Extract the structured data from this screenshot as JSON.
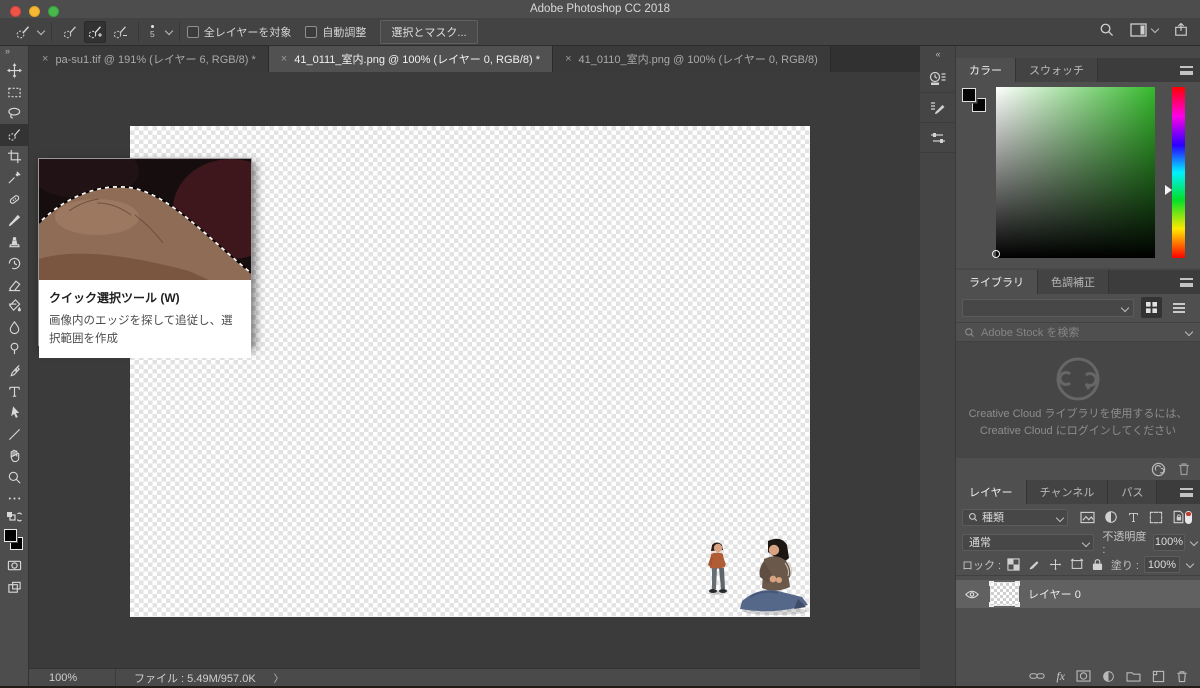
{
  "window": {
    "title": "Adobe Photoshop CC 2018"
  },
  "options_bar": {
    "brush_size": "5",
    "sample_all_layers_label": "全レイヤーを対象",
    "auto_enhance_label": "自動調整",
    "select_and_mask_label": "選択とマスク..."
  },
  "tabs": [
    {
      "label": "pa-su1.tif @ 191% (レイヤー 6, RGB/8) *",
      "active": false
    },
    {
      "label": "41_0111_室内.png @ 100% (レイヤー 0, RGB/8) *",
      "active": true
    },
    {
      "label": "41_0110_室内.png @ 100% (レイヤー 0, RGB/8)",
      "active": false
    }
  ],
  "toolbar_tools": [
    "move",
    "rectangular-marquee",
    "lasso",
    "quick-selection",
    "crop",
    "eyedropper",
    "spot-healing-brush",
    "brush",
    "clone-stamp",
    "history-brush",
    "eraser",
    "paint-bucket",
    "blur",
    "dodge",
    "pen",
    "type",
    "path-selection",
    "line",
    "hand",
    "zoom",
    "more-tools",
    "swap-colors",
    "foreground-background",
    "quick-mask",
    "screen-mode"
  ],
  "tooltip": {
    "title": "クイック選択ツール (W)",
    "description": "画像内のエッジを探して追従し、選択範囲を作成"
  },
  "color_panel": {
    "tab_color": "カラー",
    "tab_swatches": "スウォッチ",
    "hue_color": "#35b92c"
  },
  "library_panel": {
    "tab_library": "ライブラリ",
    "tab_adjustments": "色調補正",
    "search_placeholder": "Adobe Stock を検索",
    "message_line1": "Creative Cloud ライブラリを使用するには、",
    "message_line2": "Creative Cloud にログインしてください"
  },
  "layers_panel": {
    "tab_layers": "レイヤー",
    "tab_channels": "チャンネル",
    "tab_paths": "パス",
    "filter_kind_label": "種類",
    "blend_mode": "通常",
    "opacity_label": "不透明度 :",
    "opacity_value": "100%",
    "lock_label": "ロック :",
    "fill_label": "塗り :",
    "fill_value": "100%",
    "fx_label": "fx",
    "layers": [
      {
        "name": "レイヤー 0",
        "visible": true,
        "selected": true
      }
    ]
  },
  "status_bar": {
    "zoom_level": "100%",
    "file_info": "ファイル : 5.49M/957.0K"
  },
  "icons_glyphs": {
    "expand_panel": "»",
    "collapse_panel": "«",
    "status_chevron": "〉",
    "tab_close": "×"
  },
  "colors": {
    "panel_bg": "#4f4f4f",
    "canvas_surround": "#3b3b3b",
    "active_tab": "#515151",
    "selected_layer_row": "#616161",
    "checkerboard_light": "#ffffff",
    "checkerboard_dark": "#e3e3e3"
  }
}
